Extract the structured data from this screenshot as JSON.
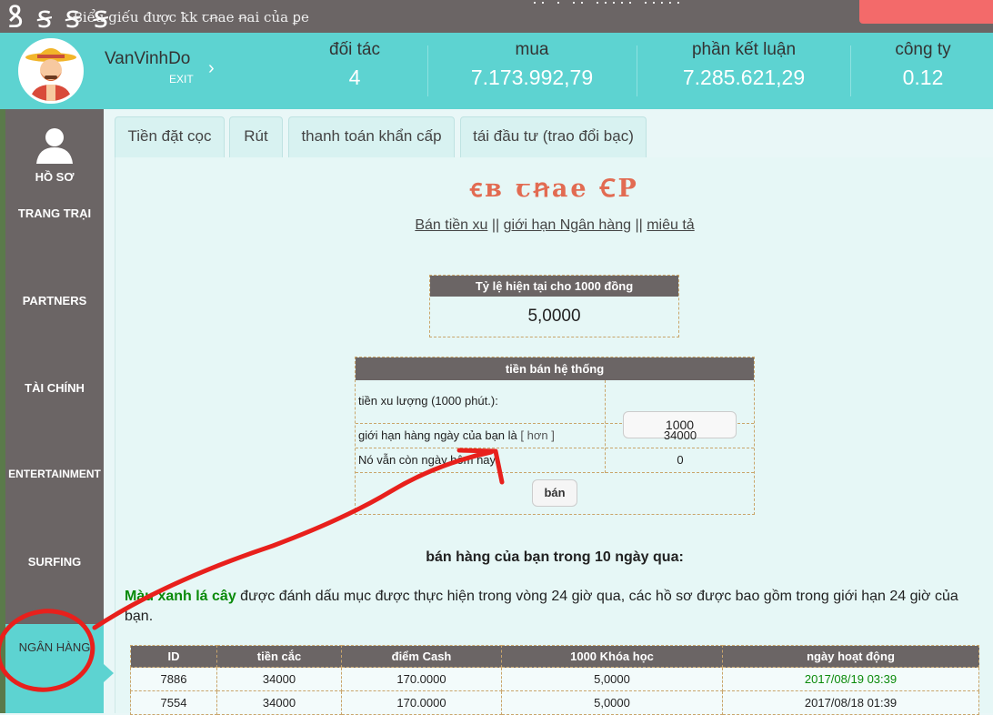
{
  "site": {
    "logo": "ꝸ ꞩ ꞩ ꞩ",
    "tagline": "Ꞗiểu giếu được ꝁk ꞇꞥae ꞥai của ꝑe"
  },
  "user": {
    "name": "VanVinhDo",
    "exit_label": "EXIT"
  },
  "stats": [
    {
      "label": "đối tác",
      "value": "4"
    },
    {
      "label": "mua",
      "value": "7.173.992,79"
    },
    {
      "label": "phần kết luận",
      "value": "7.285.621,29"
    },
    {
      "label": "công ty",
      "value": "0.12"
    }
  ],
  "sidebar": {
    "items": [
      {
        "label": "HỒ SƠ"
      },
      {
        "label": "TRANG TRẠI"
      },
      {
        "label": "PARTNERS"
      },
      {
        "label": "TÀI CHÍNH"
      },
      {
        "label": "ENTERTAINMENT"
      },
      {
        "label": "SURFING"
      },
      {
        "label": "NGÂN HÀNG"
      }
    ]
  },
  "tabs": [
    {
      "label": "Tiền đặt cọc"
    },
    {
      "label": "Rút"
    },
    {
      "label": "thanh toán khẩn cấp"
    },
    {
      "label": "tái đầu tư (trao đổi bạc)"
    }
  ],
  "panel": {
    "title": "ꞓв ꞇꞥae ꞒP",
    "links": [
      "Bán tiền xu",
      "giới hạn Ngân hàng",
      "miêu tả"
    ],
    "link_separator": "||",
    "rate_header": "Tỷ lệ hiện tại cho 1000 đồng",
    "rate_value": "5,0000",
    "system_header": "tiền bán hệ thống",
    "rows": [
      {
        "label": "tiền xu lượng (1000 phút.):",
        "value": "1000"
      },
      {
        "label": "giới hạn hàng ngày của bạn là",
        "link": "[ hơn ]",
        "value": "34000"
      },
      {
        "label": "Nó vẫn còn ngày hôm nay:",
        "value": "0"
      }
    ],
    "sell_button": "bán",
    "sales_title": "bán hàng của bạn trong 10 ngày qua:",
    "note_green": "Màu xanh lá cây",
    "note_rest": " được đánh dấu mục được thực hiện trong vòng 24 giờ qua, các hồ sơ được bao gồm trong giới hạn 24 giờ của bạn."
  },
  "table": {
    "headers": [
      "ID",
      "tiền cắc",
      "điểm Cash",
      "1000 Khóa học",
      "ngày hoạt động"
    ],
    "rows": [
      [
        "7886",
        "34000",
        "170.0000",
        "5,0000",
        "2017/08/19 03:39"
      ],
      [
        "7554",
        "34000",
        "170.0000",
        "5,0000",
        "2017/08/18 01:39"
      ]
    ],
    "highlight_color": "#0a8a0a"
  },
  "colors": {
    "accent": "#5dd3d1",
    "sidebar": "#6b6565",
    "title": "#e26b52",
    "annotation": "#e8201c"
  }
}
